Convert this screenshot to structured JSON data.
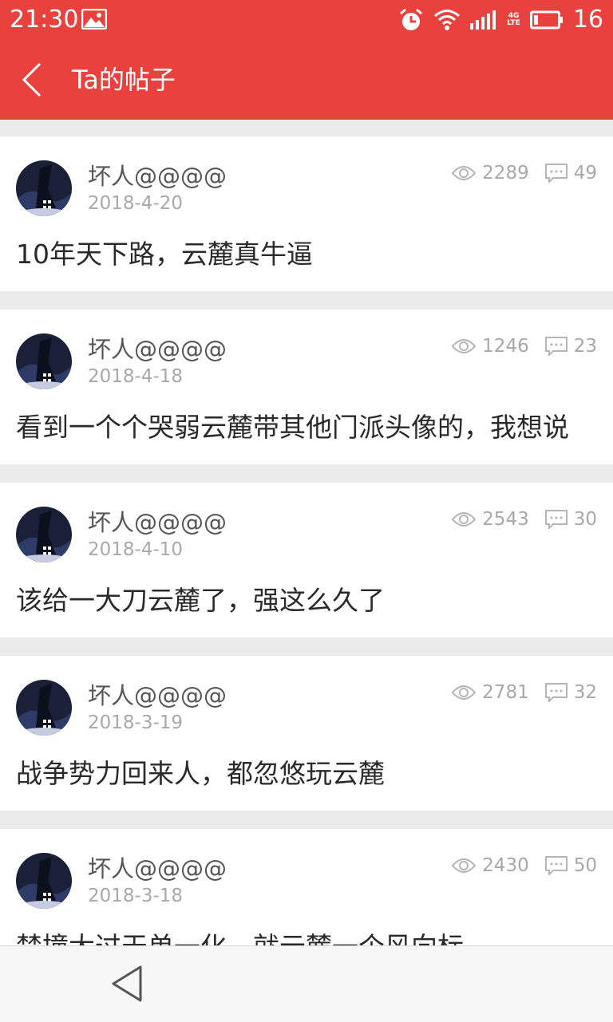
{
  "status_bar": {
    "time": "21:30",
    "network": "4G",
    "network_sub": "LTE",
    "battery": "16"
  },
  "app_bar": {
    "title": "Ta的帖子",
    "back_icon": "back-chevron-icon"
  },
  "posts": [
    {
      "username": "坏人@@@@",
      "date": "2018-4-20",
      "views": "2289",
      "comments": "49",
      "text": "10年天下路，云麓真牛逼"
    },
    {
      "username": "坏人@@@@",
      "date": "2018-4-18",
      "views": "1246",
      "comments": "23",
      "text": "看到一个个哭弱云麓带其他门派头像的，我想说"
    },
    {
      "username": "坏人@@@@",
      "date": "2018-4-10",
      "views": "2543",
      "comments": "30",
      "text": "该给一大刀云麓了，强这么久了"
    },
    {
      "username": "坏人@@@@",
      "date": "2018-3-19",
      "views": "2781",
      "comments": "32",
      "text": "战争势力回来人，都忽悠玩云麓"
    },
    {
      "username": "坏人@@@@",
      "date": "2018-3-18",
      "views": "2430",
      "comments": "50",
      "text": "禁撞大过天单一化，就云麓一个风向标"
    }
  ],
  "colors": {
    "accent": "#e8413e",
    "meta_text": "#a8a8a8",
    "separator": "#ebebeb"
  }
}
